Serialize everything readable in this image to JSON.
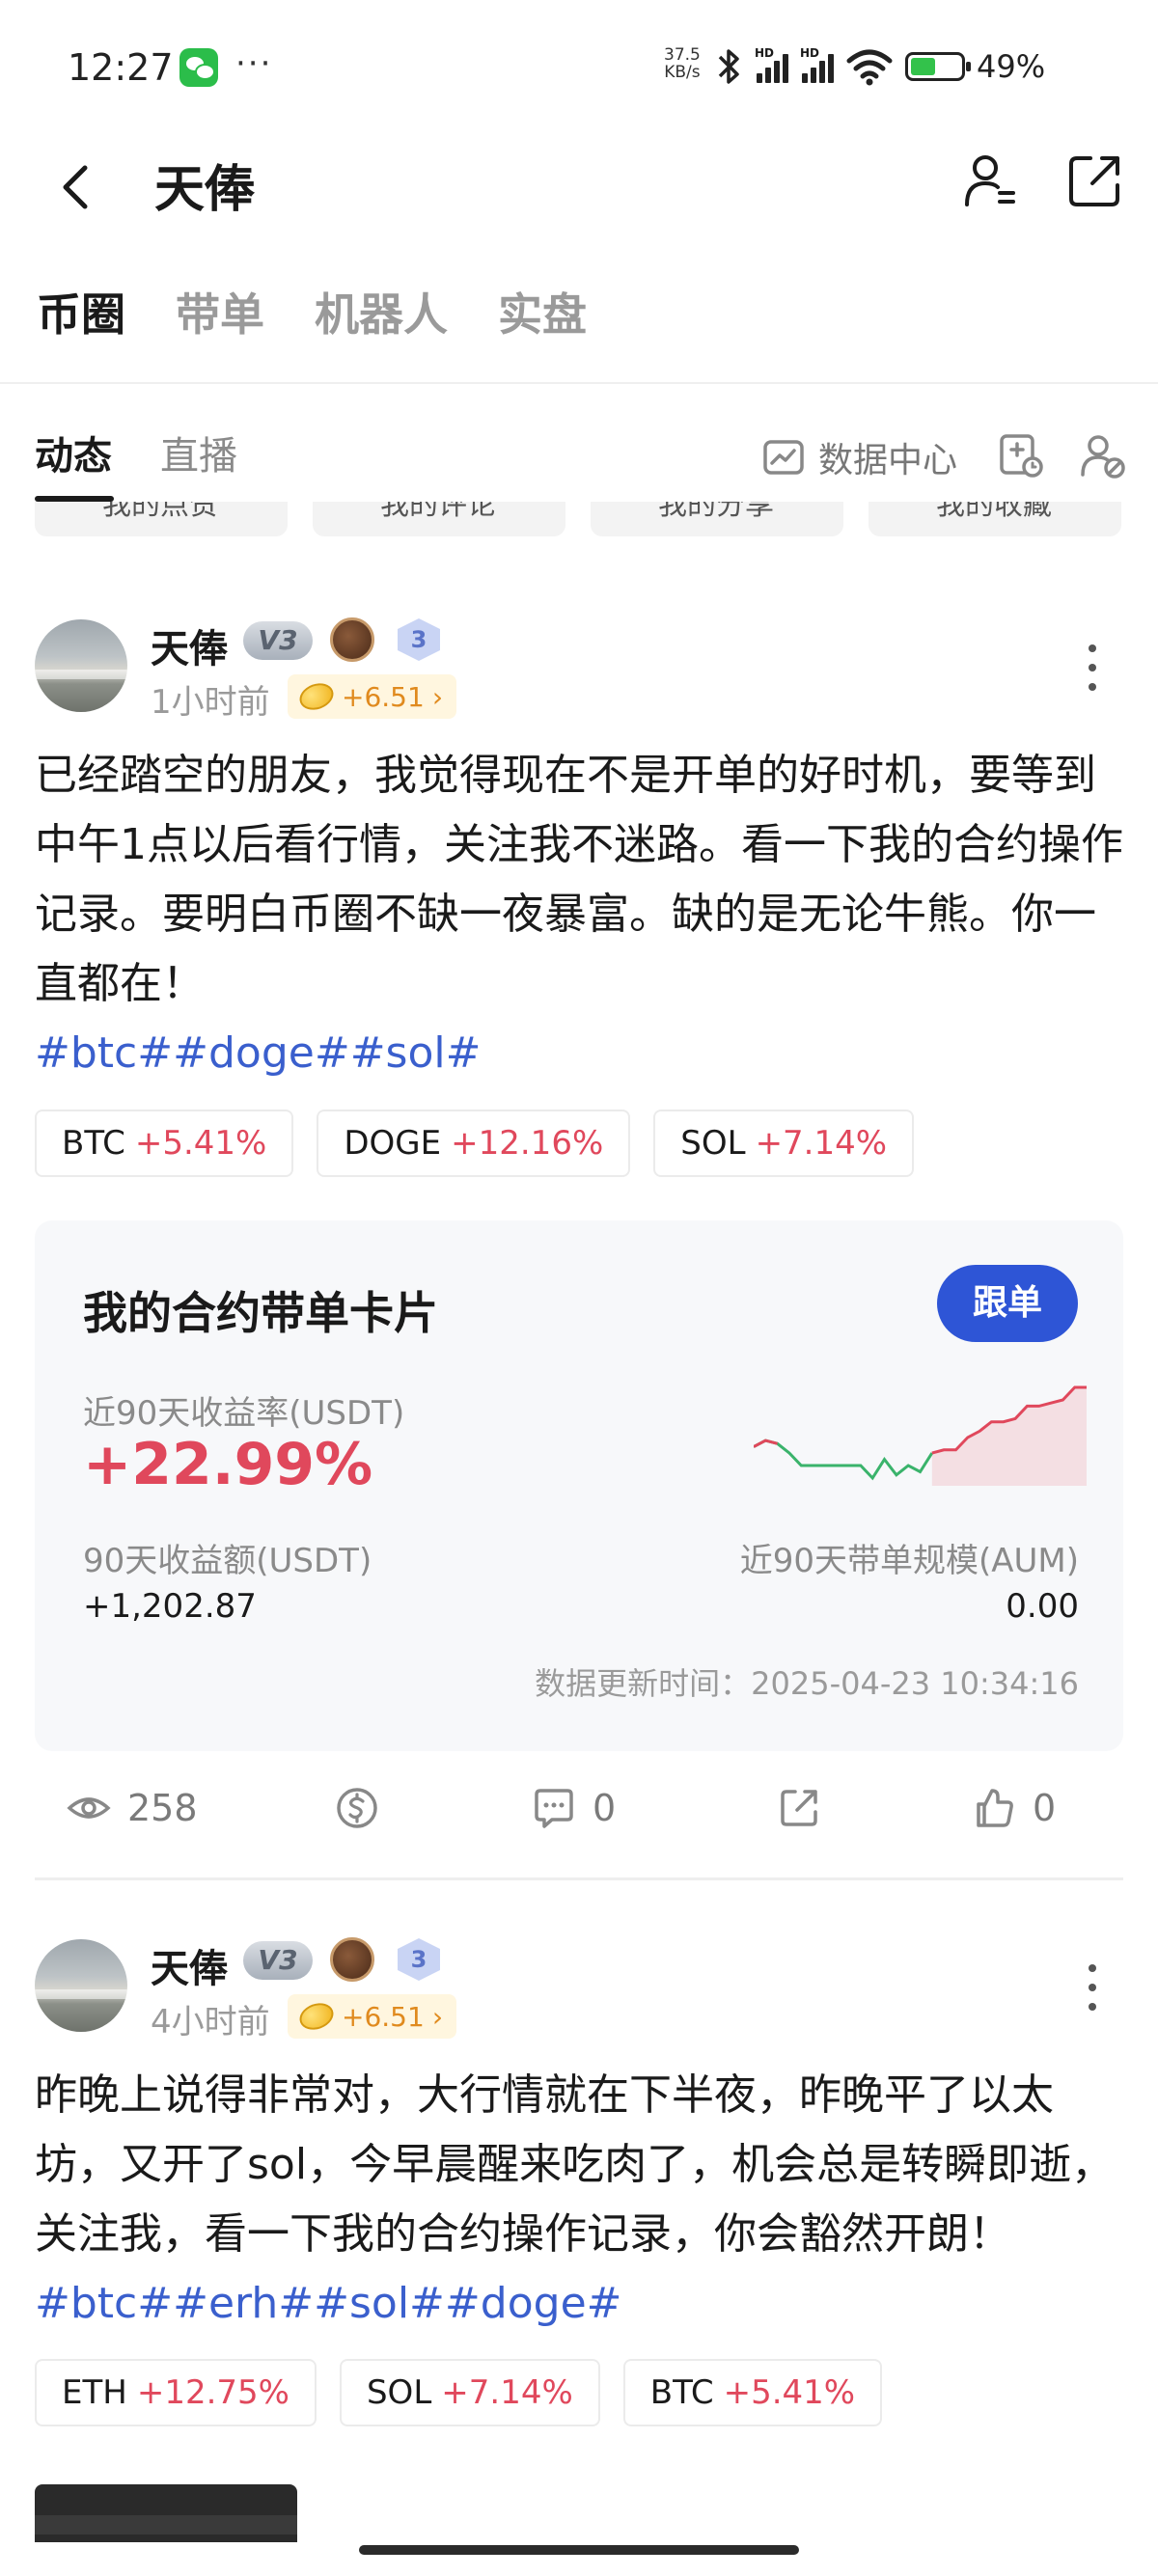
{
  "status_bar": {
    "time": "12:27",
    "more": "···",
    "net_speed_value": "37.5",
    "net_speed_unit": "KB/s",
    "battery_pct": "49%",
    "battery_level": 0.49
  },
  "header": {
    "title": "天俸"
  },
  "main_tabs": [
    "币圈",
    "带单",
    "机器人",
    "实盘"
  ],
  "sub_tabs": [
    "动态",
    "直播"
  ],
  "data_center_label": "数据中心",
  "quick_chips": [
    "我的点赞",
    "我的评论",
    "我的分享",
    "我的收藏"
  ],
  "posts": [
    {
      "username": "天俸",
      "vip": "V3",
      "level": "3",
      "time": "1小时前",
      "tip": "+6.51",
      "text": "已经踏空的朋友，我觉得现在不是开单的好时机，要等到中午1点以后看行情，关注我不迷路。看一下我的合约操作记录。要明白币圈不缺一夜暴富。缺的是无论牛熊。你一直都在！",
      "hashtags": "#btc##doge##sol#",
      "coins": [
        {
          "name": "BTC",
          "pct": "+5.41%"
        },
        {
          "name": "DOGE",
          "pct": "+12.16%"
        },
        {
          "name": "SOL",
          "pct": "+7.14%"
        }
      ],
      "card": {
        "title": "我的合约带单卡片",
        "follow": "跟单",
        "roi_label": "近90天收益率(USDT)",
        "roi_value": "+22.99%",
        "profit_label": "90天收益额(USDT)",
        "profit_value": "+1,202.87",
        "aum_label": "近90天带单规模(AUM)",
        "aum_value": "0.00",
        "updated": "数据更新时间：2025-04-23 10:34:16",
        "trend": [
          42,
          46,
          44,
          38,
          30,
          30,
          30,
          30,
          30,
          30,
          22,
          34,
          24,
          30,
          26,
          38,
          40,
          40,
          48,
          52,
          58,
          58,
          60,
          68,
          68,
          70,
          72,
          80,
          80
        ]
      },
      "stats": {
        "views": "258",
        "comments": "0",
        "likes": "0"
      }
    },
    {
      "username": "天俸",
      "vip": "V3",
      "level": "3",
      "time": "4小时前",
      "tip": "+6.51",
      "text": "昨晚上说得非常对，大行情就在下半夜，昨晚平了以太坊，又开了sol，今早晨醒来吃肉了，机会总是转瞬即逝，关注我，看一下我的合约操作记录，你会豁然开朗！",
      "hashtags": "#btc##erh##sol##doge#",
      "coins": [
        {
          "name": "ETH",
          "pct": "+12.75%"
        },
        {
          "name": "SOL",
          "pct": "+7.14%"
        },
        {
          "name": "BTC",
          "pct": "+5.41%"
        }
      ]
    }
  ]
}
